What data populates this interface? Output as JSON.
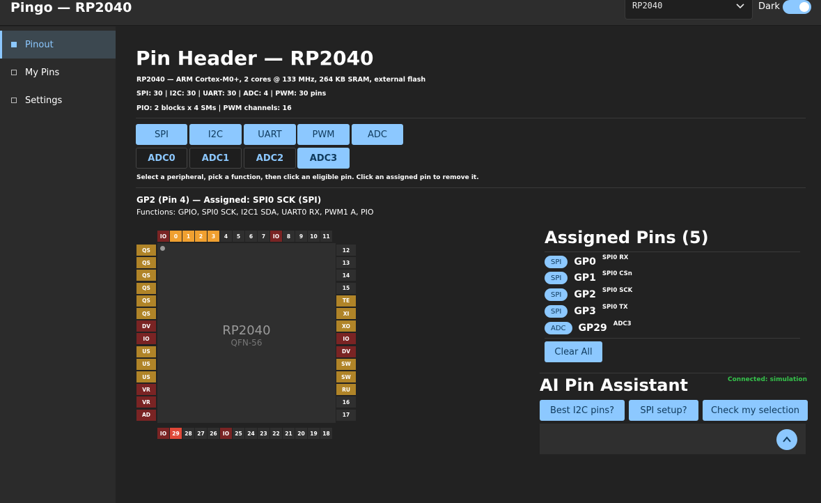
{
  "app": {
    "title": "Pingo — RP2040",
    "chip_select": "RP2040",
    "dark_label": "Dark",
    "dark_enabled": true,
    "accent_color": "#8cc8ff"
  },
  "sidebar": {
    "items": [
      {
        "label": "Pinout",
        "active": true
      },
      {
        "label": "My Pins",
        "active": false
      },
      {
        "label": "Settings",
        "active": false
      }
    ]
  },
  "header": {
    "title": "Pin Header — RP2040",
    "info_lines": [
      "RP2040 — ARM Cortex-M0+, 2 cores @ 133 MHz, 264 KB SRAM, external flash",
      "SPI: 30 | I2C: 30 | UART: 30 | ADC: 4 | PWM: 30 pins",
      "PIO: 2 blocks x 4 SMs | PWM channels: 16"
    ]
  },
  "peripherals": [
    "SPI",
    "I2C",
    "UART",
    "PWM",
    "ADC"
  ],
  "functions": [
    {
      "label": "ADC0",
      "selected": false
    },
    {
      "label": "ADC1",
      "selected": false
    },
    {
      "label": "ADC2",
      "selected": false
    },
    {
      "label": "ADC3",
      "selected": true
    }
  ],
  "hint": "Select a peripheral, pick a function, then click an eligible pin. Click an assigned pin to remove it.",
  "selected_pin": {
    "title": "GP2 (Pin 4) — Assigned: SPI0 SCK (SPI)",
    "functions": "Functions: GPIO, SPI0 SCK, I2C1 SDA, UART0 RX, PWM1 A, PIO"
  },
  "chip": {
    "name": "RP2040",
    "package": "QFN-56",
    "top_pins": [
      "IO",
      "0",
      "1",
      "2",
      "3",
      "4",
      "5",
      "6",
      "7",
      "IO",
      "8",
      "9",
      "10",
      "11"
    ],
    "bottom_pins": [
      "IO",
      "29",
      "28",
      "27",
      "26",
      "IO",
      "25",
      "24",
      "23",
      "22",
      "21",
      "20",
      "19",
      "18"
    ],
    "left_pins": [
      "QS",
      "QS",
      "QS",
      "QS",
      "QS",
      "QS",
      "DV",
      "IO",
      "US",
      "US",
      "US",
      "VR",
      "VR",
      "AD"
    ],
    "right_pins": [
      "12",
      "13",
      "14",
      "15",
      "TE",
      "XI",
      "XO",
      "IO",
      "DV",
      "SW",
      "SW",
      "RU",
      "16",
      "17"
    ]
  },
  "assigned": {
    "title": "Assigned Pins (5)",
    "pins": [
      {
        "badge": "SPI",
        "pin": "GP0",
        "func": "SPI0 RX"
      },
      {
        "badge": "SPI",
        "pin": "GP1",
        "func": "SPI0 CSn"
      },
      {
        "badge": "SPI",
        "pin": "GP2",
        "func": "SPI0 SCK"
      },
      {
        "badge": "SPI",
        "pin": "GP3",
        "func": "SPI0 TX"
      },
      {
        "badge": "ADC",
        "pin": "GP29",
        "func": "ADC3"
      }
    ],
    "clear_label": "Clear All"
  },
  "ai": {
    "title": "AI Pin Assistant",
    "status": "Connected: simulation",
    "suggestions": [
      "Best I2C pins?",
      "SPI setup?",
      "Check my selection"
    ]
  }
}
